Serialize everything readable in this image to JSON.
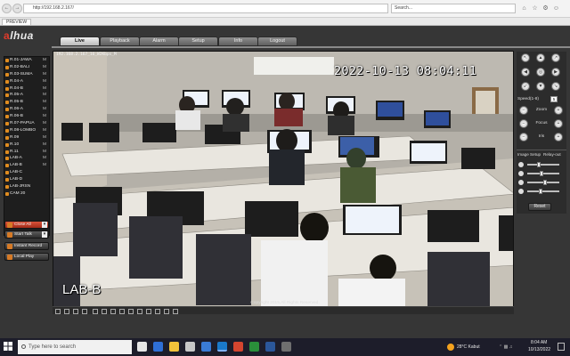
{
  "browser": {
    "url": "http://192.168.2.167/",
    "search_placeholder": "Search...",
    "tab_title": "PREVIEW"
  },
  "app": {
    "logo": "alhua",
    "menu": [
      {
        "label": "Live",
        "active": true
      },
      {
        "label": "Playback",
        "active": false
      },
      {
        "label": "Alarm",
        "active": false
      },
      {
        "label": "Setup",
        "active": false
      },
      {
        "label": "Info",
        "active": false
      },
      {
        "label": "Logout",
        "active": false
      }
    ],
    "cameras": [
      {
        "label": "R.01-JAWA",
        "flag": "M"
      },
      {
        "label": "R.02-BALI",
        "flag": "M"
      },
      {
        "label": "R.03-SUMA",
        "flag": "M"
      },
      {
        "label": "R.04-A",
        "flag": "M"
      },
      {
        "label": "R.04-B",
        "flag": "M"
      },
      {
        "label": "R.05-A",
        "flag": "M"
      },
      {
        "label": "R.05-B",
        "flag": "M"
      },
      {
        "label": "R.06-A",
        "flag": "M"
      },
      {
        "label": "R.06-B",
        "flag": "M"
      },
      {
        "label": "R.07-PAPUA",
        "flag": "M"
      },
      {
        "label": "R.08-LOMBO",
        "flag": "M"
      },
      {
        "label": "R.09",
        "flag": "M"
      },
      {
        "label": "R.10",
        "flag": "M"
      },
      {
        "label": "R.11",
        "flag": "M"
      },
      {
        "label": "LAB-A",
        "flag": "M"
      },
      {
        "label": "LAB-B",
        "flag": "M"
      },
      {
        "label": "LAB-C",
        "flag": ""
      },
      {
        "label": "LAB-D",
        "flag": ""
      },
      {
        "label": "LAB-JRSN",
        "flag": ""
      },
      {
        "label": "CAM 20",
        "flag": ""
      }
    ],
    "side_buttons": {
      "close_all": "Close All",
      "start_talk": "Start Talk",
      "instant_record": "Instant Record",
      "local_play": "Local Play"
    },
    "video": {
      "osd_info": "192.168.2.167_16_W2Kbps_M",
      "timestamp": "2022-10-13 08:04:11",
      "channel_name": "LAB-B"
    },
    "ptz": {
      "speed_label": "Speed(1-8)",
      "speed_value": "5",
      "zoom_label": "Zoom",
      "focus_label": "Focus",
      "iris_label": "Iris"
    },
    "image_setup": {
      "tab_image": "Image Setup",
      "tab_relay": "Relay-out",
      "sliders": [
        0.35,
        0.45,
        0.55,
        0.4
      ],
      "reset_label": "Reset"
    },
    "copyright": "Copyright 2015,All Rights Reserved."
  },
  "taskbar": {
    "search_placeholder": "Type here to search",
    "weather": "28°C  Kabut",
    "time": "8:04 AM",
    "date": "10/13/2022"
  }
}
